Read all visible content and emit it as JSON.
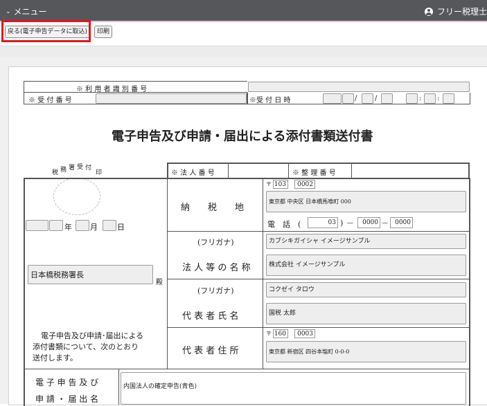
{
  "topbar": {
    "menu_label": "メニュー",
    "user_label": "フリー税理士"
  },
  "toolbar": {
    "back_label": "戻る(電子申告データに取込)",
    "print_label": "印刷"
  },
  "header_table": {
    "user_id_label": "※ 利 用 者 識 別 番 号",
    "receipt_no_label": "※ 受 付 番 号",
    "receipt_date_label": "※受 付 日 時",
    "date_sep": "/",
    "time_sep": ":"
  },
  "form": {
    "title": "電子申告及び申請・届出による添付書類送付書",
    "stamp_label_1": "税",
    "stamp_label_2": "務",
    "stamp_label_3": "署",
    "stamp_label_4": "受",
    "stamp_label_5": "付",
    "stamp_label_6": "印",
    "corp_no_label": "※ 法 人 番 号",
    "ref_no_label": "※ 整 理 番 号",
    "date_year": "年",
    "date_month": "月",
    "date_day": "日",
    "office_name": "日本橋税務署長",
    "honorific": "殿",
    "intro_text_1": "電子申告及び申請･届出による",
    "intro_text_2": "添付書類について、次のとおり",
    "intro_text_3": "送付します。",
    "tax_place_label": "納　　税　　地",
    "postal_mark": "〒",
    "zip1": "103",
    "zip2": "0002",
    "tax_address": "東京都 中央区 日本橋馬喰町 000",
    "phone_label": "電　話　(",
    "phone_1": "03",
    "phone_close": ")",
    "phone_dash": "—",
    "phone_2": "0000",
    "phone_3": "0000",
    "furigana_label_1": "(フリガナ)",
    "corp_kana": "カブシキガイシャ イメージサンプル",
    "corp_name_label": "法 人 等 の 名 称",
    "corp_name": "株式会社 イメージサンプル",
    "furigana_label_2": "(フリガナ)",
    "rep_kana": "コクゼイ タロウ",
    "rep_name_label": "代 表 者 氏 名",
    "rep_name": "国税 太郎",
    "rep_address_label": "代 表 者 住 所",
    "rep_zip1": "160",
    "rep_zip2": "0003",
    "rep_address": "東京都 新宿区 四谷本塩町 0-0-0",
    "app_name_label_1": "電 子 申 告 及 び",
    "app_name_label_2": "申 請 ・ 届 出 名",
    "app_name": "内国法人の確定申告(青色)"
  },
  "colors": {
    "topbar": "#55575a",
    "highlight": "#e8141b",
    "accent_line": "#f2b6c6"
  }
}
